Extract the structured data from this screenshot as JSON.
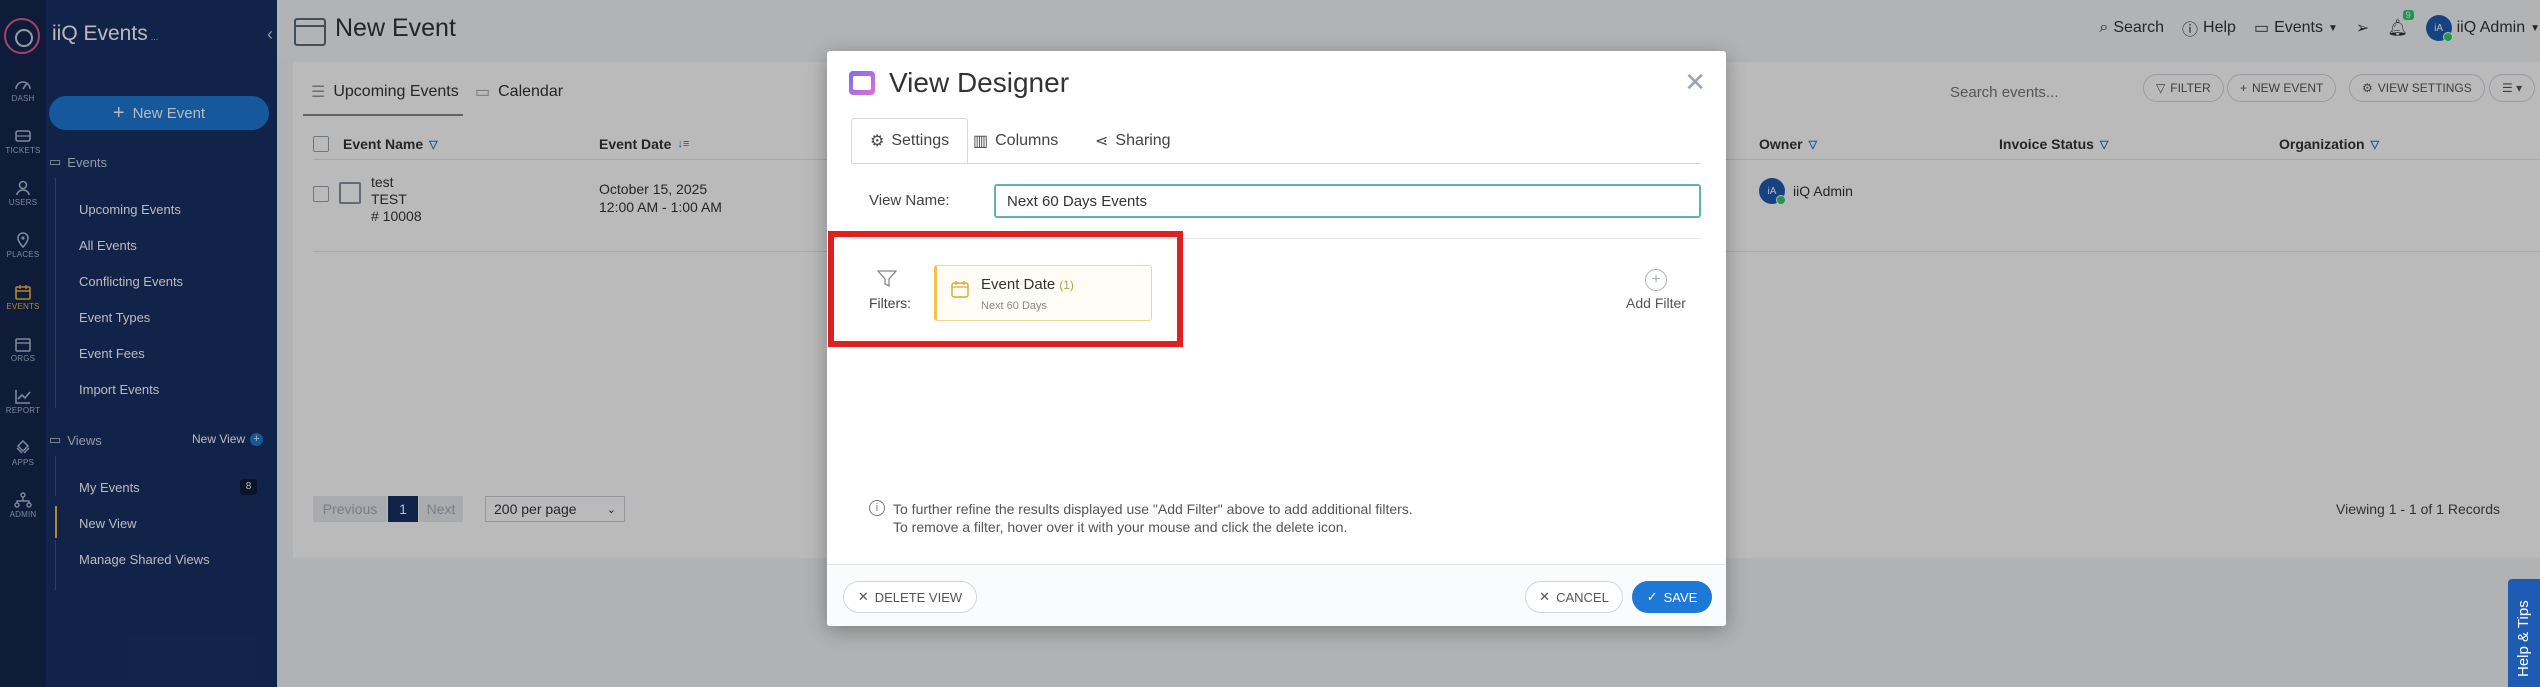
{
  "app": {
    "name": "iiQ Events",
    "suffix": "..."
  },
  "rail": {
    "items": [
      {
        "label": "DASH",
        "icon": "dashboard-icon"
      },
      {
        "label": "TICKETS",
        "icon": "ticket-icon"
      },
      {
        "label": "USERS",
        "icon": "user-icon"
      },
      {
        "label": "PLACES",
        "icon": "location-pin-icon"
      },
      {
        "label": "EVENTS",
        "icon": "calendar-icon"
      },
      {
        "label": "ORGS",
        "icon": "org-calendar-icon"
      },
      {
        "label": "REPORT",
        "icon": "report-chart-icon"
      },
      {
        "label": "APPS",
        "icon": "apps-icon"
      },
      {
        "label": "ADMIN",
        "icon": "admin-icon"
      }
    ],
    "active": "EVENTS"
  },
  "nav": {
    "new_event_button": "New Event",
    "events_section": "Events",
    "events_items": [
      "Upcoming Events",
      "All Events",
      "Conflicting Events",
      "Event Types",
      "Event Fees",
      "Import Events"
    ],
    "views_section": "Views",
    "new_view_link": "New View",
    "views_items": [
      "My Events",
      "New View",
      "Manage Shared Views"
    ],
    "my_events_count": "8",
    "active_item": "New View"
  },
  "topbar": {
    "page_title": "New Event",
    "search": "Search",
    "help": "Help",
    "events_menu": "Events",
    "notifications_count": "9",
    "user_initials": "iA",
    "user_name": "iiQ Admin"
  },
  "main": {
    "tabs": [
      "Upcoming Events",
      "Calendar"
    ],
    "search_placeholder": "Search events...",
    "buttons": {
      "filter": "FILTER",
      "new_event": "NEW EVENT",
      "view_settings": "VIEW SETTINGS"
    },
    "columns": [
      "Event Name",
      "Event Date",
      "Owner",
      "Invoice Status",
      "Organization"
    ],
    "rows": [
      {
        "name": "test",
        "type": "TEST",
        "number": "# 10008",
        "date": "October 15, 2025",
        "time": "12:00 AM - 1:00 AM",
        "owner": "iiQ Admin",
        "owner_initials": "iA"
      }
    ],
    "pager": {
      "previous": "Previous",
      "current_page": "1",
      "next": "Next",
      "per_page": "200 per page"
    },
    "viewing": "Viewing 1 - 1 of 1 Records"
  },
  "modal": {
    "title": "View Designer",
    "tabs": [
      "Settings",
      "Columns",
      "Sharing"
    ],
    "active_tab": "Settings",
    "view_name_label": "View Name:",
    "view_name_value": "Next 60 Days Events",
    "filters_label": "Filters:",
    "filter": {
      "title": "Event Date",
      "count": "(1)",
      "subtitle": "Next 60 Days"
    },
    "add_filter": "Add Filter",
    "hint_line1": "To further refine the results displayed use \"Add Filter\" above to add additional filters.",
    "hint_line2": "To remove a filter, hover over it with your mouse and click the delete icon.",
    "delete_view": "DELETE VIEW",
    "cancel": "CANCEL",
    "save": "SAVE"
  },
  "help_tab": "Help & Tips",
  "colors": {
    "rail": "#14264f",
    "nav": "#1a3166",
    "accent": "#1e79d6",
    "highlight": "#e02020",
    "active": "#f4b942"
  }
}
